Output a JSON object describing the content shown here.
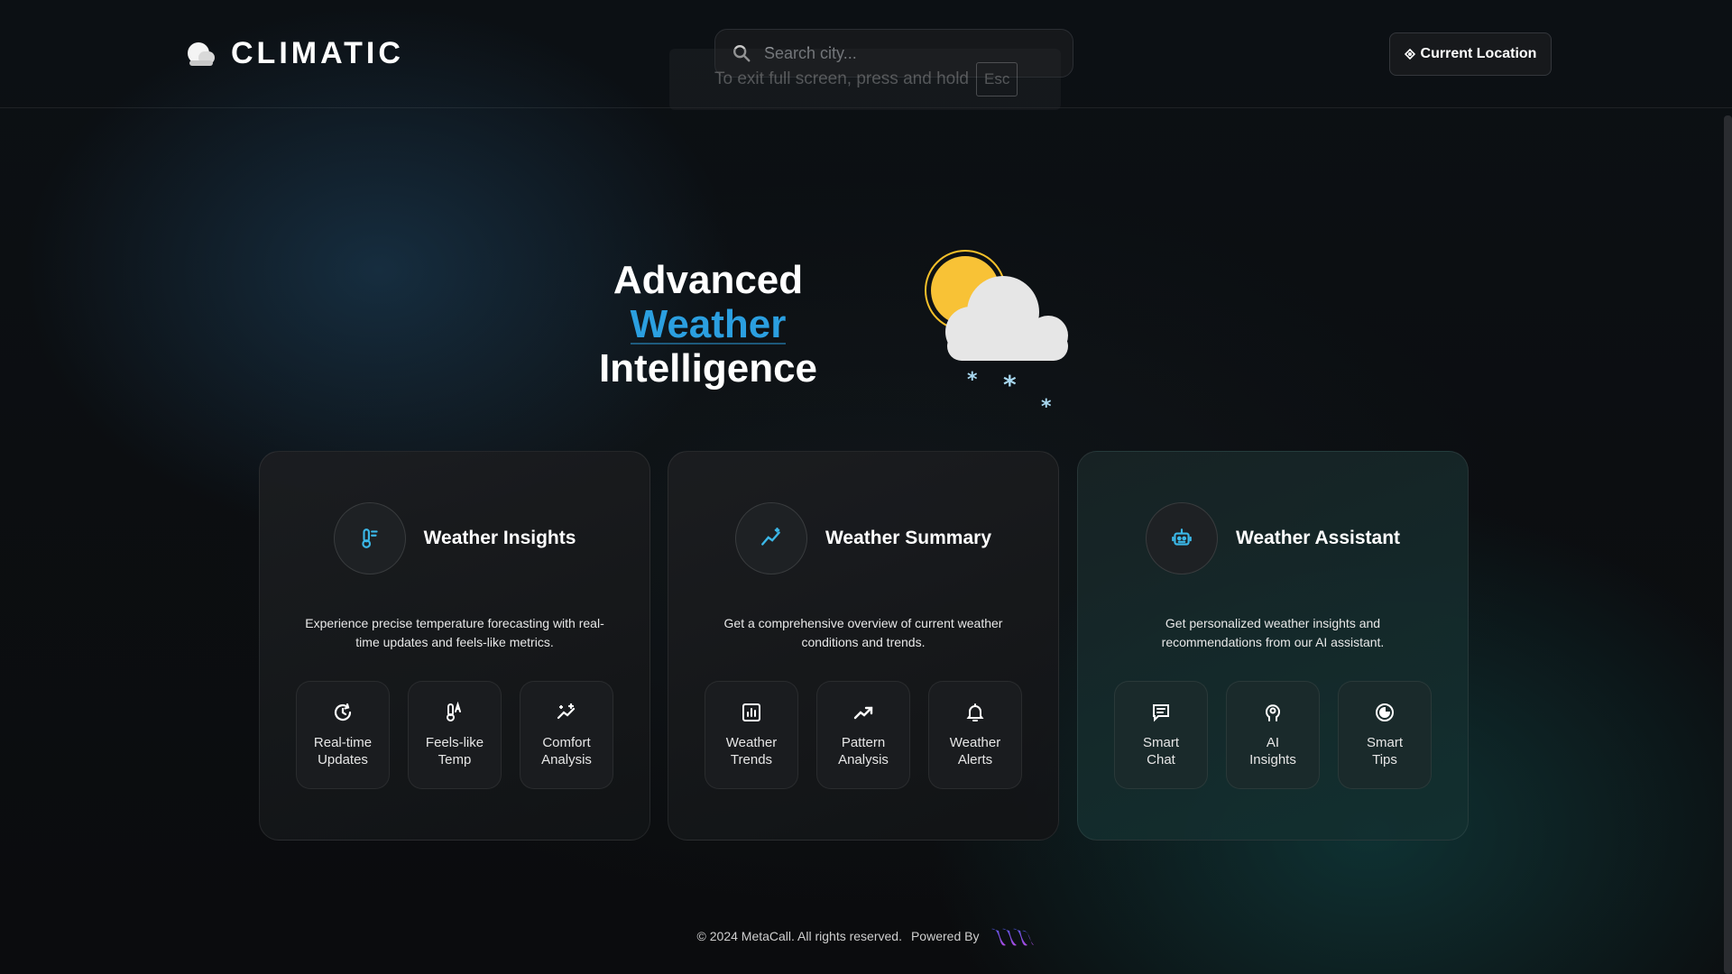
{
  "header": {
    "brand": "CLIMATIC",
    "search_placeholder": "Search city...",
    "location_button": "Current Location"
  },
  "fullscreen_notice": {
    "text": "To exit full screen, press and hold",
    "key": "Esc"
  },
  "hero": {
    "line1": "Advanced",
    "line2": "Weather",
    "line3": "Intelligence",
    "accent_color": "#2b9fe0"
  },
  "cards": [
    {
      "title": "Weather Insights",
      "icon": "thermometer-icon",
      "description": "Experience precise temperature forecasting with real-time updates and feels-like metrics.",
      "features": [
        {
          "label_line1": "Real-time",
          "label_line2": "Updates",
          "icon": "refresh-icon"
        },
        {
          "label_line1": "Feels-like",
          "label_line2": "Temp",
          "icon": "thermometer-auto-icon"
        },
        {
          "label_line1": "Comfort",
          "label_line2": "Analysis",
          "icon": "sparkle-trend-icon"
        }
      ]
    },
    {
      "title": "Weather Summary",
      "icon": "trend-sparkle-icon",
      "description": "Get a comprehensive overview of current weather conditions and trends.",
      "features": [
        {
          "label_line1": "Weather",
          "label_line2": "Trends",
          "icon": "bar-chart-icon"
        },
        {
          "label_line1": "Pattern",
          "label_line2": "Analysis",
          "icon": "trending-up-icon"
        },
        {
          "label_line1": "Weather",
          "label_line2": "Alerts",
          "icon": "bell-icon"
        }
      ]
    },
    {
      "title": "Weather Assistant",
      "icon": "robot-icon",
      "description": "Get personalized weather insights and recommendations from our AI assistant.",
      "features": [
        {
          "label_line1": "Smart",
          "label_line2": "Chat",
          "icon": "chat-icon"
        },
        {
          "label_line1": "AI",
          "label_line2": "Insights",
          "icon": "brain-gear-icon"
        },
        {
          "label_line1": "Smart",
          "label_line2": "Tips",
          "icon": "pie-icon"
        }
      ]
    }
  ],
  "footer": {
    "copyright": "© 2024 MetaCall. All rights reserved.",
    "powered_by": "Powered By"
  }
}
